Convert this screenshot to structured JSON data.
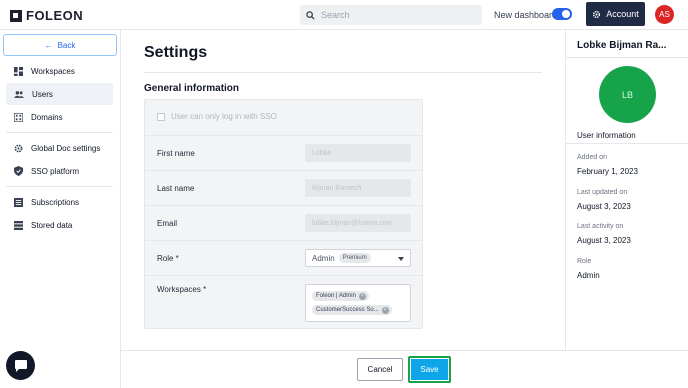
{
  "header": {
    "logo_text": "FOLEON",
    "search_placeholder": "Search",
    "new_dashboard_label": "New dashboard",
    "new_dashboard_on": true,
    "account_label": "Account",
    "avatar_initials": "AS",
    "colors": {
      "accent": "#2563eb",
      "account_bg": "#1f2a44",
      "avatar": "#dc2626"
    }
  },
  "sidebar": {
    "back_label": "Back",
    "items": [
      {
        "label": "Workspaces",
        "icon": "dashboard-icon"
      },
      {
        "label": "Users",
        "icon": "users-icon",
        "active": true
      },
      {
        "label": "Domains",
        "icon": "domain-icon"
      },
      {
        "label": "Global Doc settings",
        "icon": "gear-icon"
      },
      {
        "label": "SSO platform",
        "icon": "shield-icon"
      },
      {
        "label": "Subscriptions",
        "icon": "list-icon"
      },
      {
        "label": "Stored data",
        "icon": "database-icon"
      }
    ]
  },
  "main": {
    "title": "Settings",
    "section_title": "General information",
    "sso_label": "User can only log in with SSO",
    "fields": {
      "first_name_label": "First name",
      "first_name_value": "Lobke",
      "last_name_label": "Last name",
      "last_name_value": "Bijman Ramesh",
      "email_label": "Email",
      "email_value": "lobke.bijman@foleon.com",
      "role_label": "Role *",
      "role_value": "Admin",
      "role_badge": "Premium",
      "workspaces_label": "Workspaces *",
      "workspaces": [
        "Foleon | Admin",
        "CustomerSuccess So..."
      ]
    }
  },
  "footer": {
    "cancel_label": "Cancel",
    "save_label": "Save",
    "colors": {
      "save": "#0ea5e9",
      "highlight": "#16a34a"
    }
  },
  "right_panel": {
    "user_name": "Lobke Bijman Ra...",
    "avatar_initials": "LB",
    "section_label": "User information",
    "added_on_label": "Added on",
    "added_on_value": "February 1, 2023",
    "last_updated_label": "Last updated on",
    "last_updated_value": "August 3, 2023",
    "last_activity_label": "Last activity on",
    "last_activity_value": "August 3, 2023",
    "role_label": "Role",
    "role_value": "Admin",
    "colors": {
      "avatar": "#16a34a"
    }
  }
}
